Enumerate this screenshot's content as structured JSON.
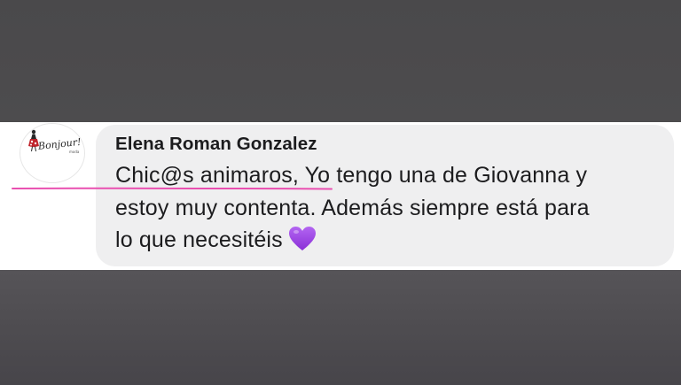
{
  "post": {
    "avatar": {
      "logo_text": "Bonjour!",
      "logo_subtext": "moda",
      "icon": "boutique-logo-avatar"
    },
    "author": "Elena Roman Gonzalez",
    "message_lines": [
      "Chic@s animaros, Yo tengo una de Giovanna y",
      "estoy muy contenta. Además siempre está para",
      "lo que necesitéis"
    ],
    "emoji": "purple-heart-icon"
  },
  "colors": {
    "background": "#4b494c",
    "strip": "#ffffff",
    "bubble": "#efeff0",
    "text": "#1c1c1e",
    "heart": "#9b3fe0",
    "highlight_line": "#e94fb0"
  }
}
